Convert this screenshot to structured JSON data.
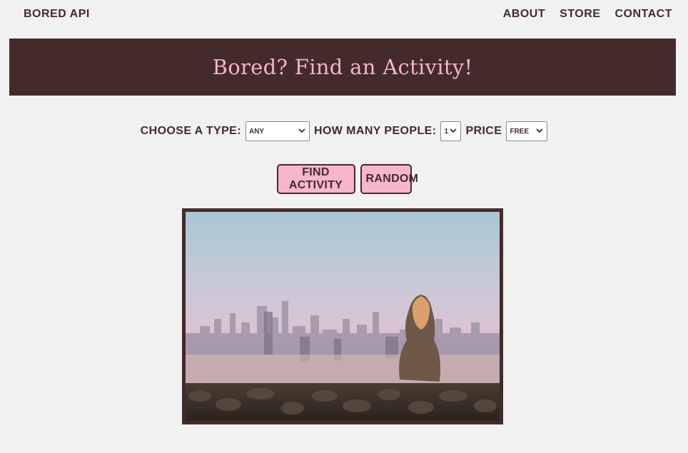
{
  "nav": {
    "brand": "Bored API",
    "links": [
      "About",
      "Store",
      "Contact"
    ]
  },
  "hero": {
    "title": "Bored? Find an Activity!"
  },
  "filters": {
    "type_label": "Choose a type:",
    "type_value": "Any",
    "people_label": "How many people:",
    "people_value": "1",
    "price_label": "Price",
    "price_value": "Free"
  },
  "actions": {
    "find_label": "Find Activity",
    "random_label": "Random"
  },
  "photo": {
    "subject": "woman sitting on stone wall overlooking city skyline"
  },
  "colors": {
    "primary": "#432b2c",
    "accent": "#f7b6cc",
    "background": "#f2f1f1"
  }
}
